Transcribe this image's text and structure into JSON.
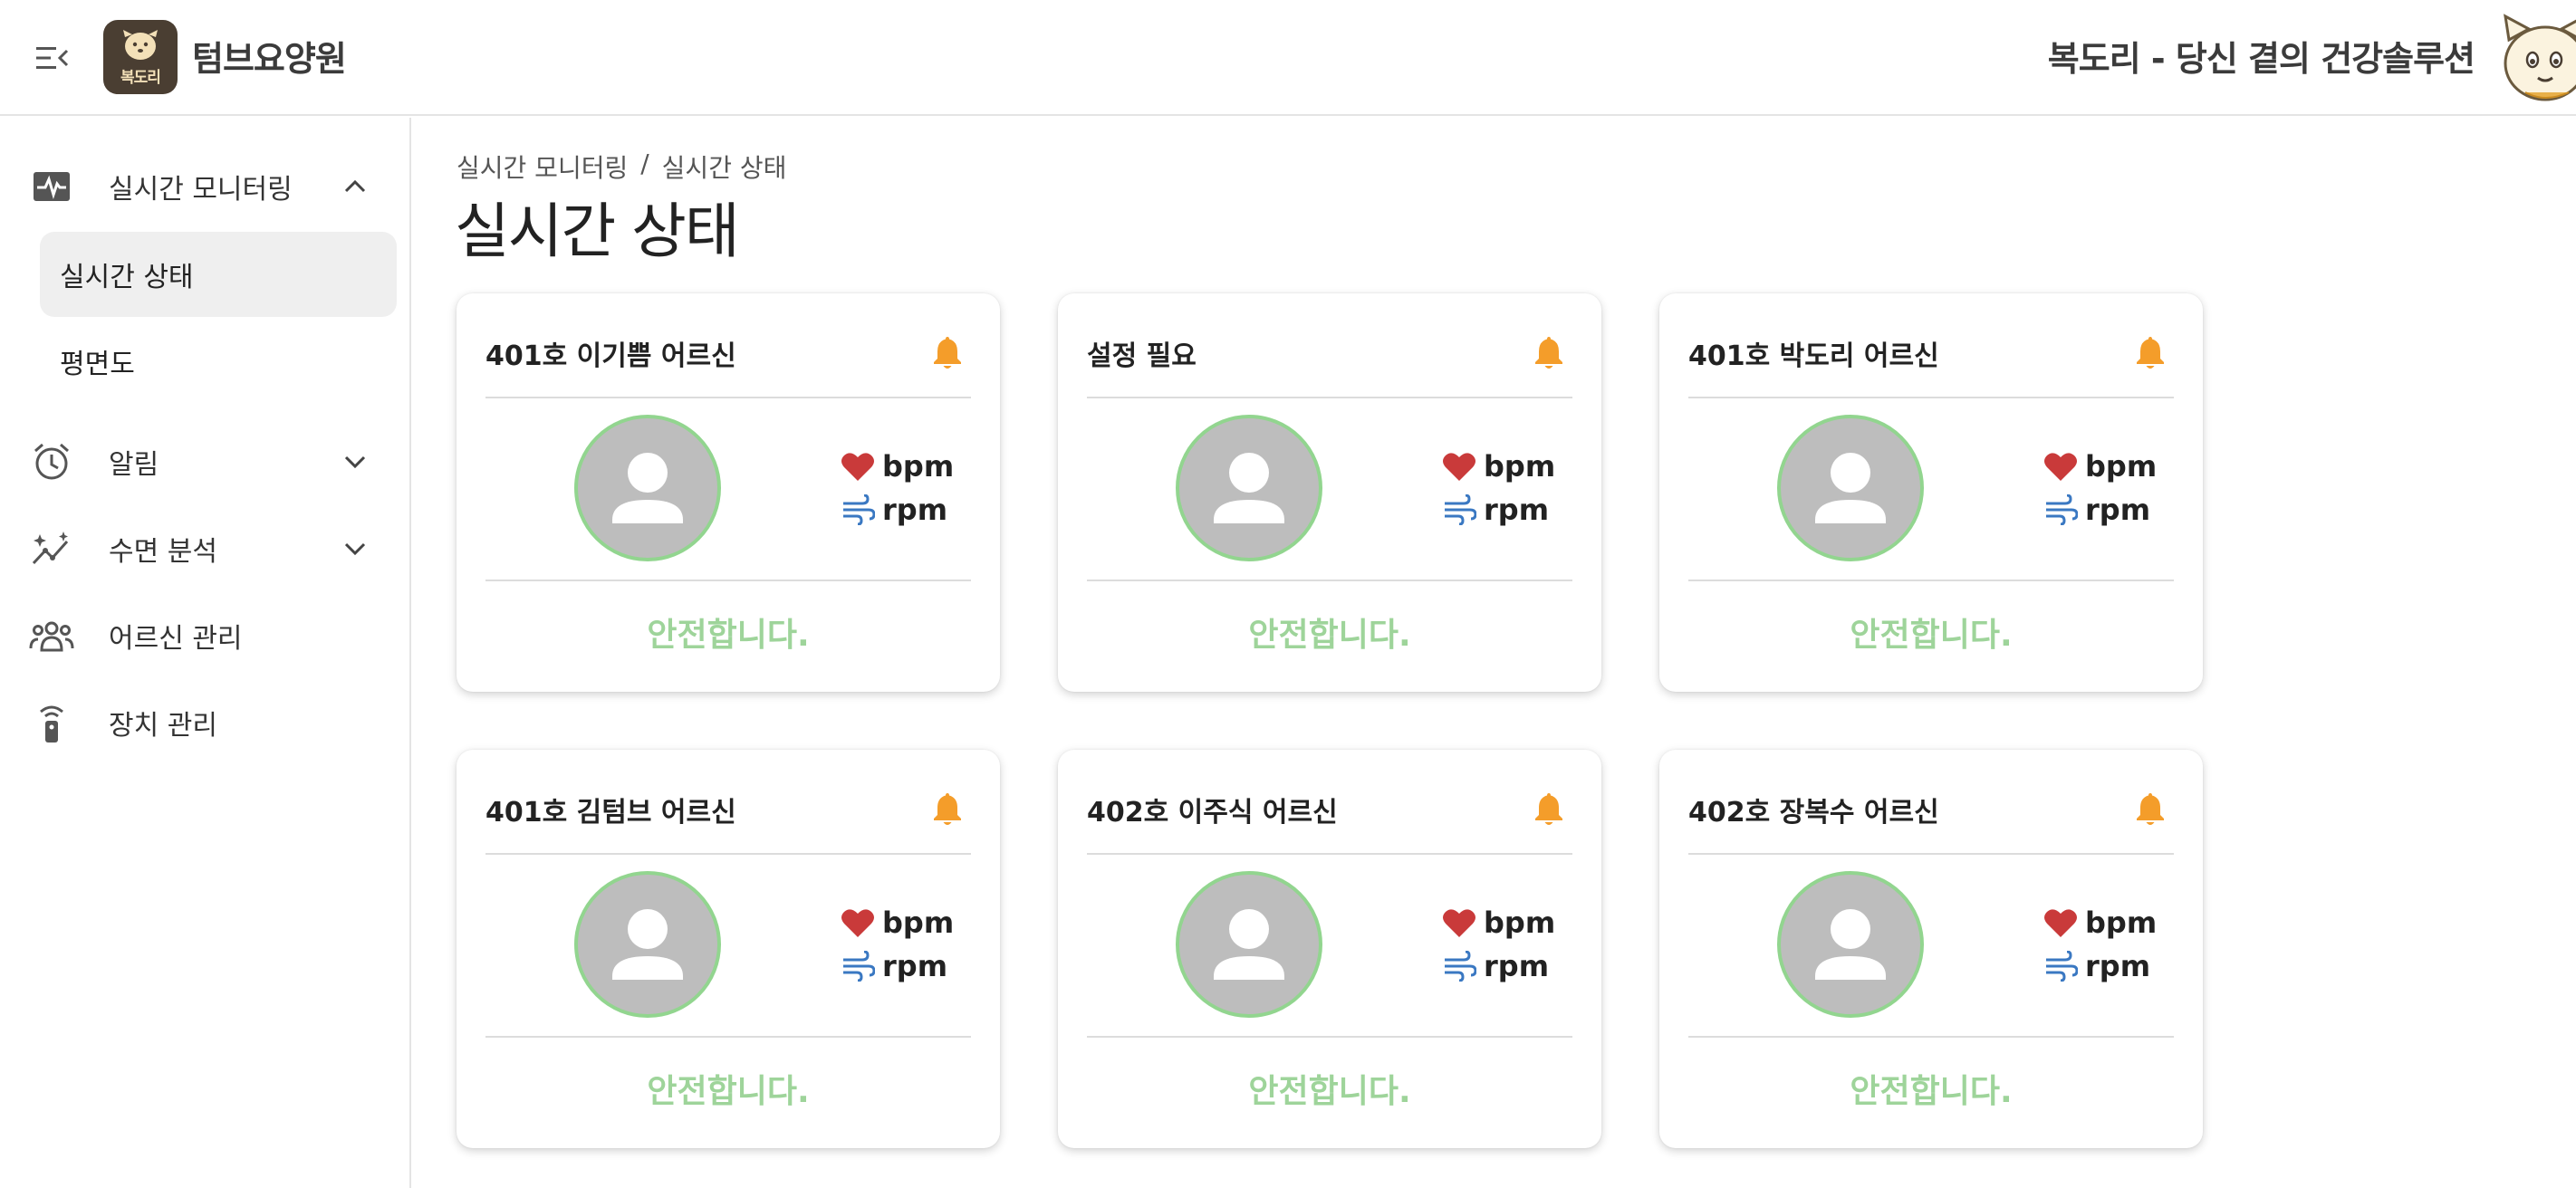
{
  "header": {
    "app_title": "텀브요양원",
    "logo_text": "복도리",
    "right_title": "복도리 - 당신 곁의 건강솔루션"
  },
  "sidebar": {
    "items": [
      {
        "label": "실시간 모니터링",
        "icon": "monitor-heart-icon",
        "expanded": true,
        "children": [
          {
            "label": "실시간 상태",
            "active": true
          },
          {
            "label": "평면도",
            "active": false
          }
        ]
      },
      {
        "label": "알림",
        "icon": "alarm-clock-icon",
        "expanded": false
      },
      {
        "label": "수면 분석",
        "icon": "trend-sparkle-icon",
        "expanded": false
      },
      {
        "label": "어르신 관리",
        "icon": "people-group-icon"
      },
      {
        "label": "장치 관리",
        "icon": "remote-device-icon"
      }
    ]
  },
  "breadcrumb": {
    "parent": "실시간 모니터링",
    "separator": "/",
    "current": "실시간 상태"
  },
  "page_title": "실시간 상태",
  "vital_units": {
    "heart": "bpm",
    "resp": "rpm"
  },
  "cards": [
    {
      "title": "401호 이기쁨 어르신",
      "status": "안전합니다."
    },
    {
      "title": "설정 필요",
      "status": "안전합니다."
    },
    {
      "title": "401호 박도리 어르신",
      "status": "안전합니다."
    },
    {
      "title": "401호 김텀브 어르신",
      "status": "안전합니다."
    },
    {
      "title": "402호 이주식 어르신",
      "status": "안전합니다."
    },
    {
      "title": "402호 장복수 어르신",
      "status": "안전합니다."
    }
  ],
  "colors": {
    "bell": "#f49d2a",
    "heart": "#c93a3a",
    "wind": "#3a78c2",
    "safe_status": "#9ed49a",
    "avatar_ring": "#92d58f",
    "avatar_bg": "#bdbdbd"
  }
}
